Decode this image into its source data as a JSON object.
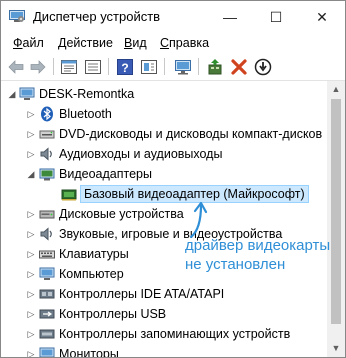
{
  "window": {
    "title": "Диспетчер устройств",
    "minimize": "—",
    "maximize": "☐",
    "close": "✕"
  },
  "menu": [
    {
      "accel": "Ф",
      "rest": "айл"
    },
    {
      "accel": "Д",
      "rest": "ействие"
    },
    {
      "accel": "В",
      "rest": "ид"
    },
    {
      "accel": "С",
      "rest": "правка"
    }
  ],
  "tree": {
    "root": "DESK-Remontka",
    "items": [
      {
        "label": "Bluetooth"
      },
      {
        "label": "DVD-дисководы и дисководы компакт-дисков"
      },
      {
        "label": "Аудиовходы и аудиовыходы"
      },
      {
        "label": "Видеоадаптеры"
      },
      {
        "label": "Базовый видеоадаптер (Майкрософт)"
      },
      {
        "label": "Дисковые устройства"
      },
      {
        "label": "Звуковые, игровые и видеоустройства"
      },
      {
        "label": "Клавиатуры"
      },
      {
        "label": "Компьютер"
      },
      {
        "label": "Контроллеры IDE ATA/ATAPI"
      },
      {
        "label": "Контроллеры USB"
      },
      {
        "label": "Контроллеры запоминающих устройств"
      },
      {
        "label": "Мониторы"
      }
    ]
  },
  "annotation": {
    "line1": "драйвер видеокарты",
    "line2": "не установлен",
    "color": "#2f8fd6"
  },
  "colors": {
    "selection_bg": "#cce8ff",
    "selection_border": "#99d1ff"
  }
}
